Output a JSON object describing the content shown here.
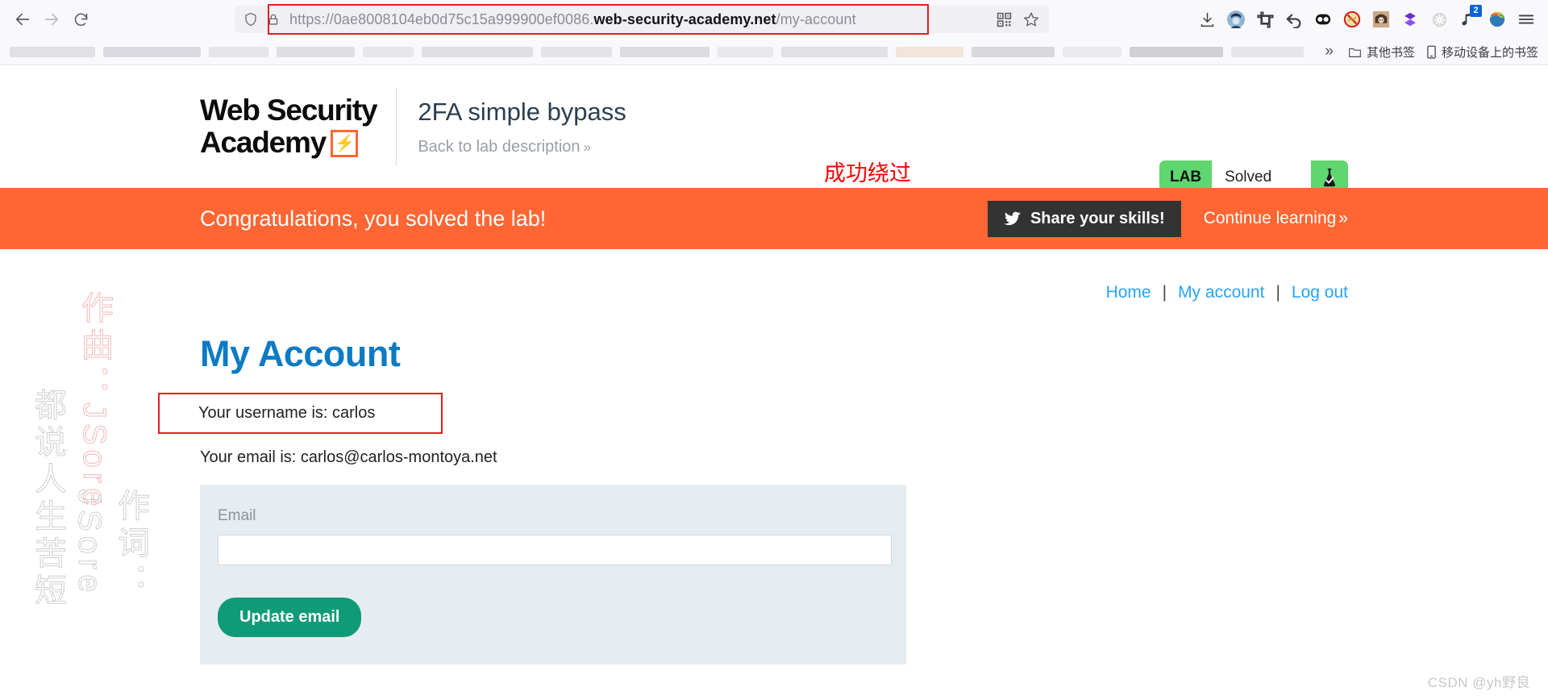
{
  "browser": {
    "nav": {
      "back_icon": "arrow-left-icon",
      "forward_icon": "arrow-right-icon",
      "reload_icon": "reload-icon"
    },
    "urlbar": {
      "shield_icon": "shield-icon",
      "lock_icon": "padlock-icon",
      "url_prefix": "https://0ae8008104eb0d75c15a999900ef0086.",
      "url_domain": "web-security-academy.net",
      "url_path": "/my-account",
      "qr_icon": "qr-code-icon",
      "bookmark_icon": "star-outline-icon"
    },
    "extensions": [
      {
        "name": "downloads-icon",
        "glyph": "⤓",
        "badge": ""
      },
      {
        "name": "account-avatar-icon",
        "glyph": "",
        "badge": ""
      },
      {
        "name": "screenshot-crop-icon",
        "glyph": "",
        "badge": ""
      },
      {
        "name": "undo-arrow-icon",
        "glyph": "↶",
        "badge": ""
      },
      {
        "name": "dark-reader-icon",
        "glyph": "",
        "badge": ""
      },
      {
        "name": "adblock-icon",
        "glyph": "",
        "badge": ""
      },
      {
        "name": "anime-avatar-icon",
        "glyph": "",
        "badge": ""
      },
      {
        "name": "dropbox-icon",
        "glyph": "",
        "badge": ""
      },
      {
        "name": "grey-gear-icon",
        "glyph": "",
        "badge": ""
      },
      {
        "name": "music-extension-icon",
        "glyph": "",
        "badge": "2"
      },
      {
        "name": "colorful-globe-icon",
        "glyph": "",
        "badge": ""
      },
      {
        "name": "hamburger-menu-icon",
        "glyph": "☰",
        "badge": ""
      }
    ],
    "bookmarks": {
      "overflow_chevron": "»",
      "folder_icon": "folder-icon",
      "other_bookmarks": "其他书签",
      "mobile_icon": "mobile-device-icon",
      "mobile_bookmarks": "移动设备上的书签"
    }
  },
  "header": {
    "logo_line1": "Web Security",
    "logo_line2": "Academy",
    "lab_title": "2FA simple bypass",
    "back_link": "Back to lab description",
    "back_chevron": "»",
    "annotation_cn": "成功绕过",
    "status": {
      "tag": "LAB",
      "state": "Solved",
      "flask_icon": "flask-check-icon",
      "color": "#5ed770"
    }
  },
  "banner": {
    "message": "Congratulations, you solved the lab!",
    "share_label": "Share your skills!",
    "twitter_icon": "twitter-bird-icon",
    "continue_label": "Continue learning",
    "continue_chevron": "»",
    "background": "#ff6633"
  },
  "account_nav": {
    "home": "Home",
    "sep1": "|",
    "my_account": "My account",
    "sep2": "|",
    "log_out": "Log out",
    "link_color": "#29a3f5"
  },
  "main": {
    "title": "My Account",
    "username_line": "Your username is: carlos",
    "email_line": "Your email is: carlos@carlos-montoya.net",
    "form": {
      "label": "Email",
      "input_value": "",
      "input_placeholder": "",
      "submit_label": "Update email",
      "submit_color": "#0f9b77"
    }
  },
  "watermarks": {
    "left_a": "作曲：JSore",
    "left_b": "作词：JSore",
    "left_c": "都说人生苦短",
    "corner": "CSDN @yh野良"
  }
}
